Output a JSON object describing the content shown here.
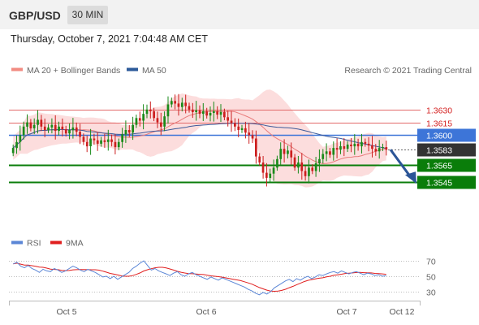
{
  "header": {
    "symbol": "GBP/USD",
    "timeframe": "30 MIN"
  },
  "datetime": "Thursday, October 7, 2021 7:04:48 AM CET",
  "legend": {
    "items": [
      {
        "label": "MA 20 + Bollinger Bands",
        "color": "#f28b82"
      },
      {
        "label": "MA 50",
        "color": "#2c5a9a"
      }
    ],
    "credit": "Research © 2021 Trading Central"
  },
  "colors": {
    "up": "#1a8a1a",
    "down": "#cc1f1f",
    "resistance": "#e26a6a",
    "pivot": "#3d75d8",
    "support": "#0a7d0a",
    "current": "#333333",
    "bands": "#fbd5d5",
    "ma20": "#e87a7a",
    "ma50": "#3c5a99",
    "arrow": "#2b5597"
  },
  "rsi_legend": [
    {
      "label": "RSI",
      "color": "#5b86d6"
    },
    {
      "label": "9MA",
      "color": "#e01e1e"
    }
  ],
  "rsi_levels": [
    "70",
    "50",
    "30"
  ],
  "x_labels": [
    "Oct 5",
    "Oct 6",
    "Oct 7",
    "Oct 12"
  ],
  "chart_data": {
    "type": "candlestick",
    "ylim": [
      1.349,
      1.3665
    ],
    "levels": [
      {
        "label": "1.3630",
        "value": 1.363,
        "kind": "resistance"
      },
      {
        "label": "1.3615",
        "value": 1.3615,
        "kind": "resistance"
      },
      {
        "label": "1.3600",
        "value": 1.36,
        "kind": "pivot"
      },
      {
        "label": "1.3583",
        "value": 1.3583,
        "kind": "current"
      },
      {
        "label": "1.3565",
        "value": 1.3565,
        "kind": "support"
      },
      {
        "label": "1.3545",
        "value": 1.3545,
        "kind": "support"
      }
    ],
    "closes": [
      1.3585,
      1.3592,
      1.36,
      1.361,
      1.3615,
      1.3608,
      1.3612,
      1.3618,
      1.361,
      1.3606,
      1.3609,
      1.3612,
      1.3605,
      1.361,
      1.3607,
      1.3602,
      1.3606,
      1.3609,
      1.3604,
      1.3598,
      1.3592,
      1.3587,
      1.3596,
      1.3594,
      1.359,
      1.3594,
      1.3592,
      1.3595,
      1.3592,
      1.3586,
      1.3592,
      1.3601,
      1.3606,
      1.3603,
      1.3612,
      1.362,
      1.3617,
      1.3625,
      1.363,
      1.3628,
      1.362,
      1.3615,
      1.361,
      1.3622,
      1.3636,
      1.364,
      1.3637,
      1.3633,
      1.3638,
      1.3634,
      1.363,
      1.3627,
      1.3629,
      1.3625,
      1.3628,
      1.3623,
      1.3626,
      1.3628,
      1.3624,
      1.3627,
      1.3621,
      1.3617,
      1.3614,
      1.361,
      1.3606,
      1.3608,
      1.3603,
      1.36,
      1.3596,
      1.3575,
      1.3568,
      1.3556,
      1.355,
      1.3555,
      1.3562,
      1.3572,
      1.3584,
      1.3578,
      1.3582,
      1.3574,
      1.3562,
      1.3568,
      1.3558,
      1.3552,
      1.3562,
      1.3558,
      1.3567,
      1.3572,
      1.3578,
      1.3581,
      1.3577,
      1.3585,
      1.3583,
      1.3587,
      1.3584,
      1.3589,
      1.3587,
      1.359,
      1.3587,
      1.3592,
      1.359,
      1.3588,
      1.3584,
      1.3581,
      1.3585,
      1.3586,
      1.3583
    ],
    "ma_windows": [
      20,
      50
    ],
    "rsi": {
      "levels": [
        70,
        50,
        30
      ],
      "values": [
        66,
        68,
        63,
        61,
        64,
        60,
        58,
        55,
        59,
        57,
        56,
        60,
        58,
        55,
        57,
        60,
        63,
        61,
        58,
        56,
        59,
        57,
        55,
        52,
        49,
        50,
        47,
        50,
        46,
        49,
        52,
        55,
        60,
        63,
        67,
        70,
        64,
        58,
        60,
        57,
        55,
        53,
        51,
        54,
        56,
        52,
        50,
        53,
        55,
        52,
        50,
        48,
        46,
        49,
        47,
        45,
        48,
        46,
        44,
        42,
        40,
        38,
        36,
        33,
        31,
        28,
        26,
        29,
        27,
        30,
        35,
        38,
        41,
        44,
        46,
        43,
        47,
        45,
        48,
        50,
        47,
        49,
        52,
        51,
        53,
        55,
        56,
        54,
        57,
        55,
        53,
        55,
        56,
        54,
        52,
        54,
        53,
        51,
        52,
        50,
        51
      ]
    }
  }
}
